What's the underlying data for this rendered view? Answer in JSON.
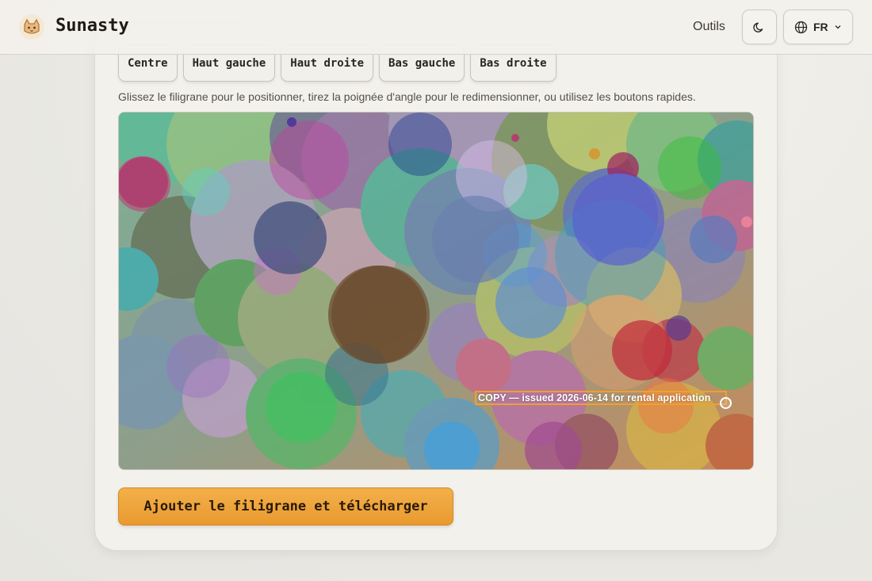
{
  "header": {
    "brand": "Sunasty",
    "nav_tools": "Outils",
    "theme_icon": "moon-icon",
    "language": "FR",
    "language_icon": "globe-icon",
    "chevron_icon": "chevron-down-icon"
  },
  "position_buttons": [
    {
      "label": "Centre"
    },
    {
      "label": "Haut gauche"
    },
    {
      "label": "Haut droite"
    },
    {
      "label": "Bas gauche"
    },
    {
      "label": "Bas droite"
    }
  ],
  "hint": "Glissez le filigrane pour le positionner, tirez la poignée d'angle pour le redimensionner, ou utilisez les boutons rapides.",
  "watermark": {
    "text": "COPY — issued 2026-06-14 for rental application",
    "box_color": "#f0a030"
  },
  "submit_label": "Ajouter le filigrane et télécharger",
  "colors": {
    "accent": "#e99a2f",
    "background": "#ecebe6",
    "card": "#f3f1ec"
  }
}
